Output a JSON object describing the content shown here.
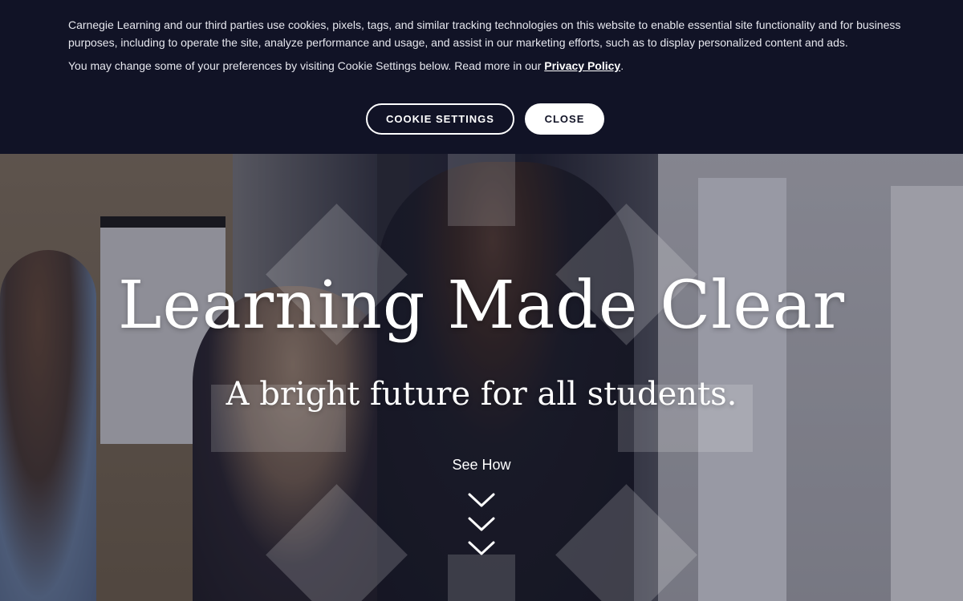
{
  "cookie_banner": {
    "text_primary": "Carnegie Learning and our third parties use cookies, pixels, tags, and similar tracking technologies on this website to enable essential site functionality and for business purposes, including to operate the site, analyze performance and usage, and assist in our marketing efforts, such as to display personalized content and ads.",
    "text_secondary_prefix": "You may change some of your preferences by visiting Cookie Settings below. Read more in our ",
    "privacy_link": "Privacy Policy",
    "text_secondary_suffix": ".",
    "settings_button": "COOKIE SETTINGS",
    "close_button": "CLOSE"
  },
  "hero": {
    "title": "Learning Made Clear",
    "subtitle": "A bright future for all students.",
    "cta_label": "See How",
    "cta_icon": "chevron-down-triple-icon"
  },
  "colors": {
    "banner_bg": "#111326",
    "text_light": "#ffffff",
    "button_dark_text": "#111326"
  }
}
